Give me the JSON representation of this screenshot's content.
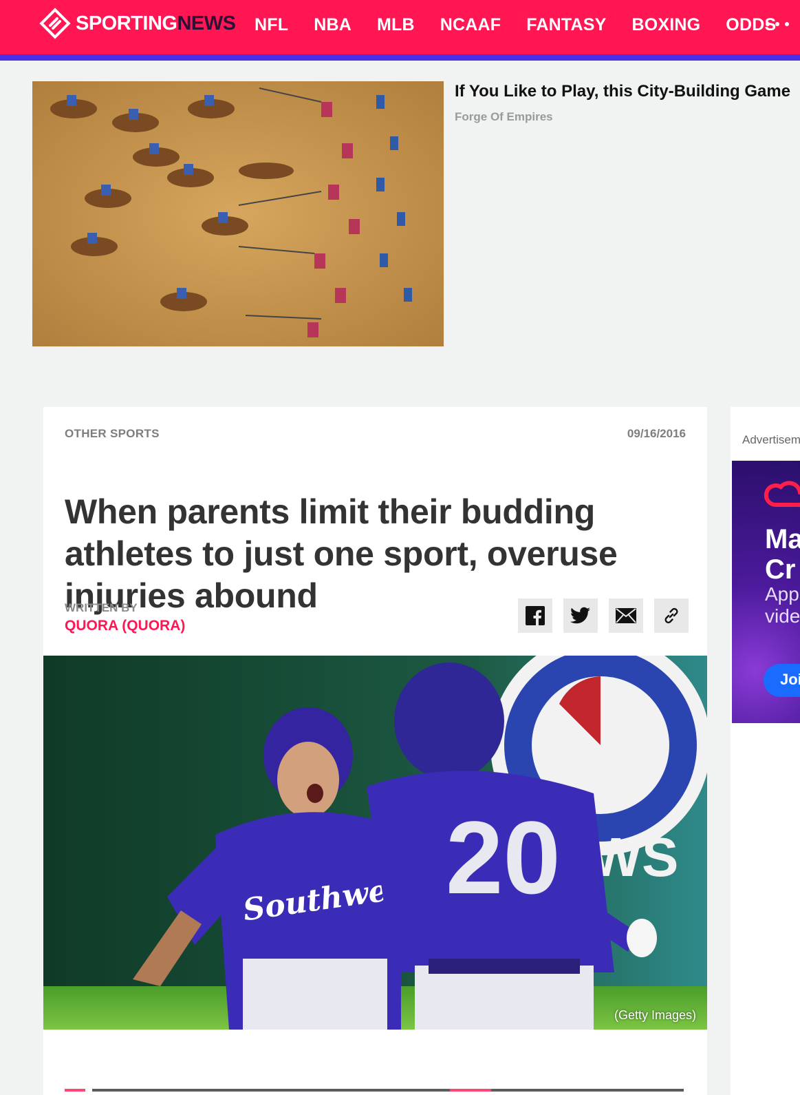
{
  "nav": {
    "logo_left": "SPORTING",
    "logo_right": "NEWS",
    "items": [
      "NFL",
      "NBA",
      "MLB",
      "NCAAF",
      "FANTASY",
      "BOXING",
      "ODDS"
    ],
    "more_icon": "ellipsis-icon",
    "brand_color": "#ff1653",
    "stripe_color": "#4a2ee8"
  },
  "promo": {
    "title": "If You Like to Play, this City-Building Game",
    "source": "Forge Of Empires"
  },
  "article": {
    "category": "OTHER SPORTS",
    "date": "09/16/2016",
    "headline": "When parents limit their budding athletes to just one sport, overuse injuries abound",
    "byline_label": "WRITTEN BY",
    "author": "QUORA (QUORA)",
    "share_icons": [
      "facebook-icon",
      "twitter-icon",
      "email-icon",
      "link-icon"
    ],
    "hero_caption": "(Getty Images)"
  },
  "rail": {
    "ad_label": "Advertiseme",
    "ad_line1": "Ma",
    "ad_line1b": "Cr",
    "ad_line2": "Apps",
    "ad_line2b": "vide",
    "ad_button": "Joi"
  }
}
